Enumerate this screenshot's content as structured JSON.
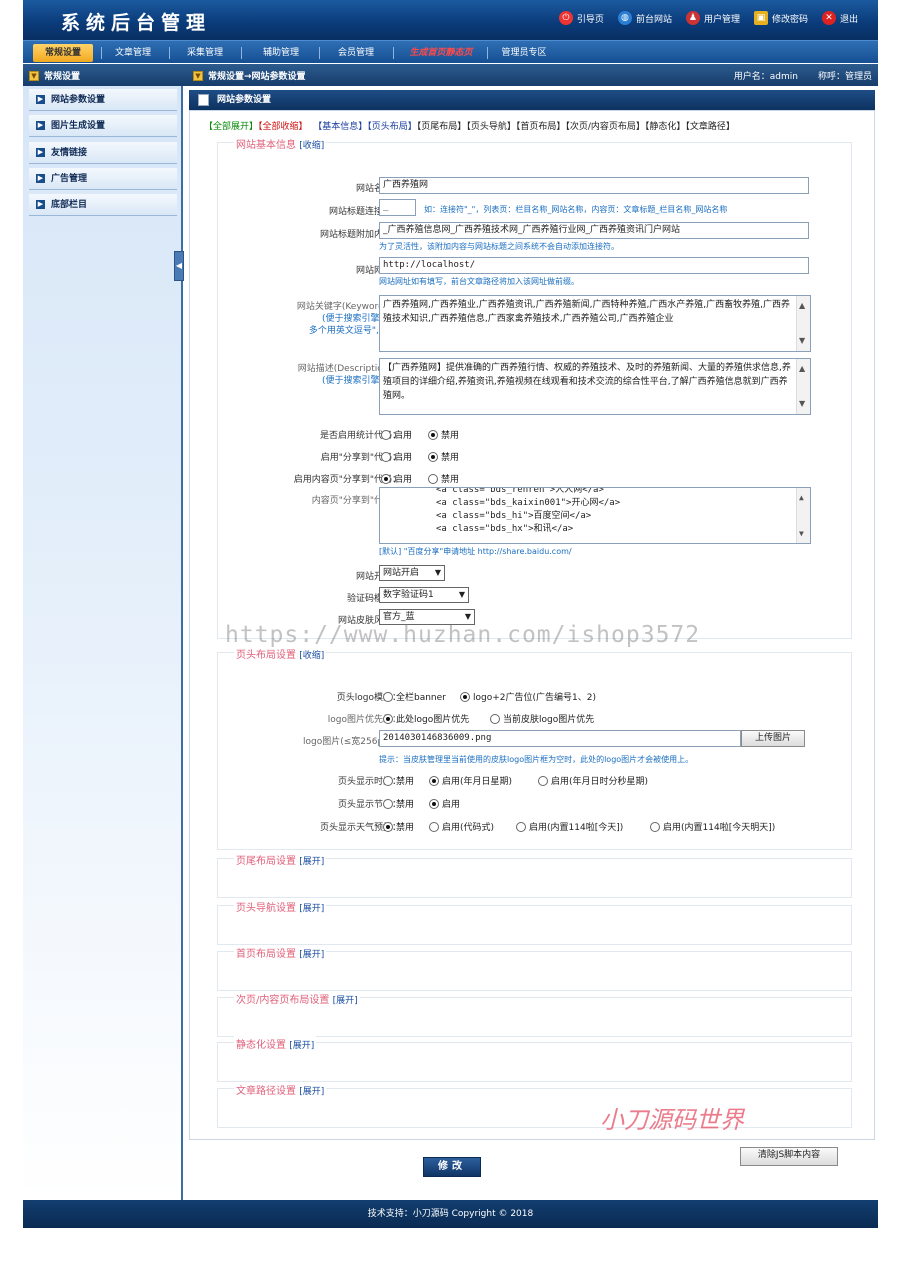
{
  "header": {
    "title": "系统后台管理",
    "links": [
      {
        "label": "引导页",
        "icon": "power-icon",
        "color": "#e33"
      },
      {
        "label": "前台网站",
        "icon": "globe-icon",
        "color": "#2a7fd4"
      },
      {
        "label": "用户管理",
        "icon": "user-icon",
        "color": "#c33"
      },
      {
        "label": "修改密码",
        "icon": "lock-icon",
        "color": "#e5b020"
      },
      {
        "label": "退出",
        "icon": "close-icon",
        "color": "#d22"
      }
    ]
  },
  "menu": {
    "items": [
      "常规设置",
      "文章管理",
      "采集管理",
      "辅助管理",
      "会员管理",
      "生成首页静态页",
      "管理员专区"
    ],
    "active": "常规设置"
  },
  "crumb": {
    "left": "常规设置",
    "middle": "常规设置→网站参数设置",
    "user_label": "用户名：admin",
    "role_label": "称呼：管理员"
  },
  "sidebar": {
    "items": [
      "网站参数设置",
      "图片生成设置",
      "友情链接",
      "广告管理",
      "底部栏目"
    ]
  },
  "panel": {
    "title": "网站参数设置",
    "tabs": {
      "expand_all": "【全部展开】",
      "collapse_all": "【全部收缩】",
      "items": [
        "【基本信息】",
        "【页头布局】",
        "【页尾布局】",
        "【页头导航】",
        "【首页布局】",
        "【次页/内容页布局】",
        "【静态化】",
        "【文章路径】"
      ]
    }
  },
  "basic": {
    "legend": "网站基本信息",
    "toggle": "[收缩]",
    "site_name_label": "网站名称：",
    "site_name_value": "广西养殖网",
    "title_sep_label": "网站标题连接符：",
    "title_sep_value": "_",
    "title_sep_hint": "如：连接符\"_\"，列表页：栏目名称_网站名称，内容页：文章标题_栏目名称_网站名称",
    "title_append_label": "网站标题附加内容：",
    "title_append_value": "_广西养殖信息网_广西养殖技术网_广西养殖行业网_广西养殖资讯门户网站",
    "title_append_hint": "为了灵活性，该附加内容与网站标题之间系统不会自动添加连接符。",
    "url_label": "网站网址：",
    "url_value": "http://localhost/",
    "url_hint": "网站网址如有填写，前台文章路径将加入该网址做前缀。",
    "keywords_label": "网站关键字(Keywords)：",
    "keywords_sub1": "(便于搜索引擎搜到)",
    "keywords_sub2": "多个用英文逗号\",\"隔开",
    "keywords_value": "广西养殖网,广西养殖业,广西养殖资讯,广西养殖新闻,广西特种养殖,广西水产养殖,广西畜牧养殖,广西养殖技术知识,广西养殖信息,广西家禽养殖技术,广西养殖公司,广西养殖企业",
    "desc_label": "网站描述(Description)：",
    "desc_sub": "(便于搜索引擎搜到)",
    "desc_value": "【广西养殖网】提供准确的广西养殖行情、权威的养殖技术、及时的养殖新闻、大量的养殖供求信息,养殖项目的详细介绍,养殖资讯,养殖视频在线观看和技术交流的综合性平台,了解广西养殖信息就到广西养殖网。",
    "stats_label": "是否启用统计代码：",
    "share_label": "启用\"分享到\"代码：",
    "content_share_label": "启用内容页\"分享到\"代码：",
    "share_code_label": "内容页\"分享到\"代码：",
    "share_code_lines": [
      "<a class=\"bds_renren\">人人网</a>",
      "<a class=\"bds_kaixin001\">开心网</a>",
      "<a class=\"bds_hi\">百度空间</a>",
      "<a class=\"bds_hx\">和讯</a>"
    ],
    "share_code_hint": "[默认] \"百度分享\"申请地址 http://share.baidu.com/",
    "enable": "启用",
    "disable": "禁用",
    "switch_label": "网站开关：",
    "switch_value": "网站开启",
    "captcha_label": "验证码模式：",
    "captcha_value": "数字验证码1",
    "skin_label": "网站皮肤风格：",
    "skin_value": "官方_蓝"
  },
  "header_layout": {
    "legend": "页头布局设置",
    "toggle": "[收缩]",
    "logo_mode_label": "页头logo模式：",
    "logo_mode_opt1": "全栏banner",
    "logo_mode_opt2": "logo+2广告位(广告编号1、2)",
    "logo_pri_label": "logo图片优先级：",
    "logo_pri_opt1": "此处logo图片优先",
    "logo_pri_opt2": "当前皮肤logo图片优先",
    "logo_img_label": "logo图片(≤宽256px)：",
    "logo_img_value": "2014030146836009.png",
    "upload_label": "上传图片",
    "logo_hint": "提示：当皮肤管理里当前使用的皮肤logo图片框为空时，此处的logo图片才会被使用上。",
    "time_label": "页头显示时间：",
    "time_opt1": "禁用",
    "time_opt2": "启用(年月日星期)",
    "time_opt3": "启用(年月日时分秒星期)",
    "holiday_label": "页头显示节日：",
    "holiday_opt1": "禁用",
    "holiday_opt2": "启用",
    "weather_label": "页头显示天气预报：",
    "weather_opt1": "禁用",
    "weather_opt2": "启用(代码式)",
    "weather_opt3": "启用(内置114啦[今天])",
    "weather_opt4": "启用(内置114啦[今天明天])"
  },
  "collapsed_sections": [
    {
      "legend": "页尾布局设置",
      "toggle": "[展开]"
    },
    {
      "legend": "页头导航设置",
      "toggle": "[展开]"
    },
    {
      "legend": "首页布局设置",
      "toggle": "[展开]"
    },
    {
      "legend": "次页/内容页布局设置",
      "toggle": "[展开]"
    },
    {
      "legend": "静态化设置",
      "toggle": "[展开]"
    },
    {
      "legend": "文章路径设置",
      "toggle": "[展开]"
    }
  ],
  "actions": {
    "submit": "修改",
    "clear_js": "清除JS脚本内容"
  },
  "watermarks": {
    "url": "https://www.huzhan.com/ishop3572",
    "brand": "小刀源码世界"
  },
  "footer": {
    "text": "技术支持：小刀源码 Copyright © 2018"
  }
}
